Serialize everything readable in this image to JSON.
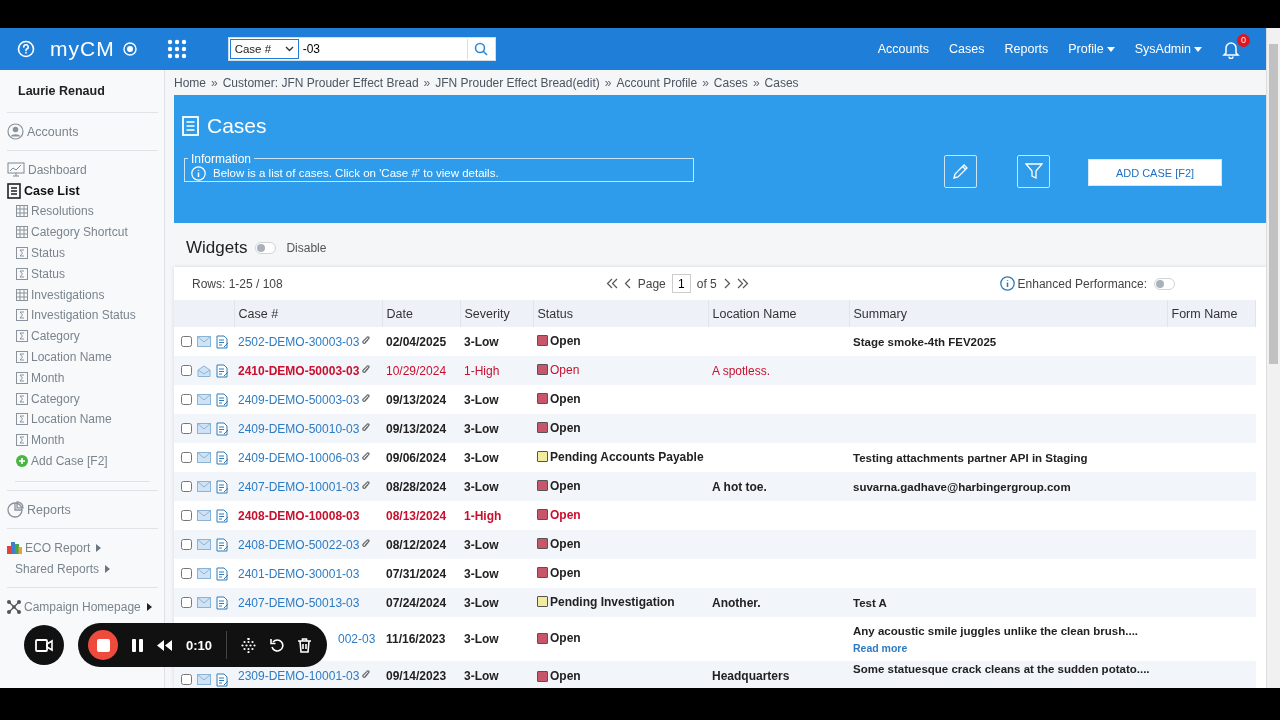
{
  "topbar": {
    "logo": "myCM",
    "search": {
      "field": "Case #",
      "value": "-03"
    },
    "nav": [
      {
        "label": "Accounts",
        "menu": false
      },
      {
        "label": "Cases",
        "menu": false
      },
      {
        "label": "Reports",
        "menu": false
      },
      {
        "label": "Profile",
        "menu": true
      },
      {
        "label": "SysAdmin",
        "menu": true
      }
    ],
    "notifications": "0"
  },
  "sidebar": {
    "user": "Laurie Renaud",
    "accounts": "Accounts",
    "dashboard": "Dashboard",
    "case_list": {
      "label": "Case List",
      "selected": true
    },
    "items": [
      {
        "label": "Resolutions",
        "kind": "table"
      },
      {
        "label": "Category Shortcut",
        "kind": "table"
      },
      {
        "label": "Status",
        "kind": "summary"
      },
      {
        "label": "Status",
        "kind": "summary"
      },
      {
        "label": "Investigations",
        "kind": "table"
      },
      {
        "label": "Investigation Status",
        "kind": "summary"
      },
      {
        "label": "Category",
        "kind": "summary"
      },
      {
        "label": "Location Name",
        "kind": "summary"
      },
      {
        "label": "Month",
        "kind": "summary"
      },
      {
        "label": "Category",
        "kind": "summary"
      },
      {
        "label": "Location Name",
        "kind": "summary"
      },
      {
        "label": "Month",
        "kind": "summary"
      },
      {
        "label": "Add Case [F2]",
        "kind": "action"
      }
    ],
    "reports": "Reports",
    "report_links": [
      {
        "label": "ECO Report",
        "kind": "chart"
      },
      {
        "label": "Shared Reports",
        "kind": "plain"
      }
    ],
    "campaign": "Campaign Homepage"
  },
  "breadcrumb": {
    "items": [
      "Home",
      "Customer: JFN Prouder Effect Bread",
      "JFN Prouder Effect Bread(edit)",
      "Account Profile",
      "Cases",
      "Cases"
    ],
    "separators": [
      "»",
      "»",
      "»",
      "»",
      "»"
    ]
  },
  "header": {
    "title": "Cases",
    "info_legend": "Information",
    "info_text": "Below is a list of cases. Click on 'Case #' to view details.",
    "add_button": "ADD CASE [F2]"
  },
  "widgets": {
    "title": "Widgets",
    "on": false,
    "label": "Disable"
  },
  "pager": {
    "rows": "Rows: 1-25 / 108",
    "page_label": "Page",
    "page": "1",
    "of": "of 5",
    "enhanced_label": "Enhanced Performance:",
    "enhanced_on": false
  },
  "table": {
    "columns": [
      "Case #",
      "Date",
      "Severity",
      "Status",
      "Location Name",
      "Summary",
      "Form Name"
    ],
    "rows": [
      {
        "selected": false,
        "mail_opened": false,
        "case": "2502-DEMO-30003-03",
        "attachment": true,
        "date": "02/04/2025",
        "severity": "3-Low",
        "status": {
          "label": "Open",
          "color": "#c8566a"
        },
        "location": "",
        "summary": "Stage smoke-4th FEV2025",
        "alert": false,
        "bold": true
      },
      {
        "selected": false,
        "mail_opened": true,
        "case": "2410-DEMO-50003-03",
        "attachment": true,
        "date": "10/29/2024",
        "severity": "1-High",
        "status": {
          "label": "Open",
          "color": "#c8566a"
        },
        "location": "A spotless.",
        "summary": "",
        "alert": true,
        "bold": false
      },
      {
        "selected": false,
        "mail_opened": false,
        "case": "2409-DEMO-50003-03",
        "attachment": true,
        "date": "09/13/2024",
        "severity": "3-Low",
        "status": {
          "label": "Open",
          "color": "#c8566a"
        },
        "location": "",
        "summary": "",
        "alert": false,
        "bold": true
      },
      {
        "selected": false,
        "mail_opened": false,
        "case": "2409-DEMO-50010-03",
        "attachment": true,
        "date": "09/13/2024",
        "severity": "3-Low",
        "status": {
          "label": "Open",
          "color": "#c8566a"
        },
        "location": "",
        "summary": "",
        "alert": false,
        "bold": true
      },
      {
        "selected": false,
        "mail_opened": false,
        "case": "2409-DEMO-10006-03",
        "attachment": true,
        "date": "09/06/2024",
        "severity": "3-Low",
        "status": {
          "label": "Pending Accounts Payable",
          "color": "#f3ec9c"
        },
        "location": "",
        "summary": "Testing attachments partner API in Staging",
        "alert": false,
        "bold": true
      },
      {
        "selected": false,
        "mail_opened": false,
        "case": "2407-DEMO-10001-03",
        "attachment": true,
        "date": "08/28/2024",
        "severity": "3-Low",
        "status": {
          "label": "Open",
          "color": "#c8566a"
        },
        "location": "A hot toe.",
        "summary": "suvarna.gadhave@harbingergroup.com",
        "alert": false,
        "bold": true
      },
      {
        "selected": false,
        "mail_opened": false,
        "case": "2408-DEMO-10008-03",
        "attachment": false,
        "date": "08/13/2024",
        "severity": "1-High",
        "status": {
          "label": "Open",
          "color": "#c8566a"
        },
        "location": "",
        "summary": "",
        "alert": true,
        "bold": true
      },
      {
        "selected": false,
        "mail_opened": false,
        "case": "2408-DEMO-50022-03",
        "attachment": true,
        "date": "08/12/2024",
        "severity": "3-Low",
        "status": {
          "label": "Open",
          "color": "#c8566a"
        },
        "location": "",
        "summary": "",
        "alert": false,
        "bold": true
      },
      {
        "selected": false,
        "mail_opened": false,
        "case": "2401-DEMO-30001-03",
        "attachment": false,
        "date": "07/31/2024",
        "severity": "3-Low",
        "status": {
          "label": "Open",
          "color": "#c8566a"
        },
        "location": "",
        "summary": "",
        "alert": false,
        "bold": true
      },
      {
        "selected": false,
        "mail_opened": false,
        "case": "2407-DEMO-50013-03",
        "attachment": false,
        "date": "07/24/2024",
        "severity": "3-Low",
        "status": {
          "label": "Pending Investigation",
          "color": "#f3ec9c"
        },
        "location": "Another.",
        "summary": "Test A",
        "alert": false,
        "bold": true
      },
      {
        "hidden_by_overlay": true,
        "case": "002-03",
        "attachment": false,
        "date": "11/16/2023",
        "severity": "3-Low",
        "status": {
          "label": "Open",
          "color": "#c8566a"
        },
        "location": "",
        "summary": "Any acoustic smile juggles unlike the clean brush....",
        "read_more": "Read more",
        "alert": false,
        "bold": true
      },
      {
        "selected": false,
        "mail_opened": false,
        "case": "2309-DEMO-10001-03",
        "attachment": true,
        "date": "09/14/2023",
        "severity": "3-Low",
        "status": {
          "label": "Open",
          "color": "#c8566a"
        },
        "location": "Headquarters",
        "summary": "Some statuesque crack cleans at the sudden potato....",
        "alert": false,
        "bold": true
      }
    ]
  },
  "recorder": {
    "time": "0:10"
  }
}
